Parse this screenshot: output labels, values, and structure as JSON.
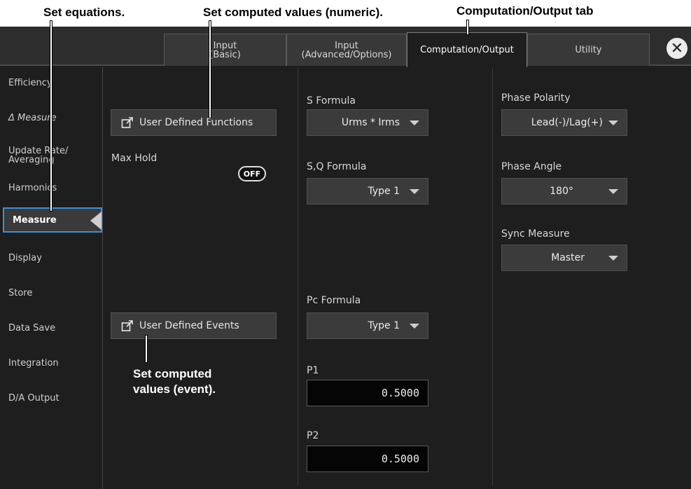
{
  "annotations": {
    "set_equations": "Set equations.",
    "set_numeric": "Set computed values (numeric).",
    "tab_callout": "Computation/Output tab",
    "set_event_line1": "Set computed",
    "set_event_line2": "values (event)."
  },
  "tabs": [
    {
      "label": "Input\n(Basic)",
      "active": false
    },
    {
      "label": "Input\n(Advanced/Options)",
      "active": false
    },
    {
      "label": "Computation/Output",
      "active": true
    },
    {
      "label": "Utility",
      "active": false
    }
  ],
  "close_icon": "close-icon",
  "sidebar": {
    "items": [
      {
        "label": "Efficiency"
      },
      {
        "label": "Δ Measure"
      },
      {
        "label": "Update Rate/\nAveraging"
      },
      {
        "label": "Harmonics"
      },
      {
        "label": "Measure",
        "active": true
      },
      {
        "label": "Display"
      },
      {
        "label": "Store"
      },
      {
        "label": "Data Save"
      },
      {
        "label": "Integration"
      },
      {
        "label": "D/A Output"
      }
    ]
  },
  "col1": {
    "user_defined_functions": "User Defined Functions",
    "max_hold_label": "Max Hold",
    "max_hold_value": "OFF",
    "user_defined_events": "User Defined Events",
    "icon": "external-window-icon"
  },
  "col2": {
    "s_formula_label": "S Formula",
    "s_formula_value": "Urms * Irms",
    "sq_formula_label": "S,Q Formula",
    "sq_formula_value": "Type 1",
    "pc_formula_label": "Pc Formula",
    "pc_formula_value": "Type 1",
    "p1_label": "P1",
    "p1_value": "0.5000",
    "p2_label": "P2",
    "p2_value": "0.5000"
  },
  "col3": {
    "phase_polarity_label": "Phase Polarity",
    "phase_polarity_value": "Lead(-)/Lag(+)",
    "phase_angle_label": "Phase Angle",
    "phase_angle_value": "180°",
    "sync_measure_label": "Sync Measure",
    "sync_measure_value": "Master"
  },
  "colors": {
    "accent": "#3a8fd8",
    "background": "#1e1e1e",
    "panel": "#3b3b3b"
  }
}
